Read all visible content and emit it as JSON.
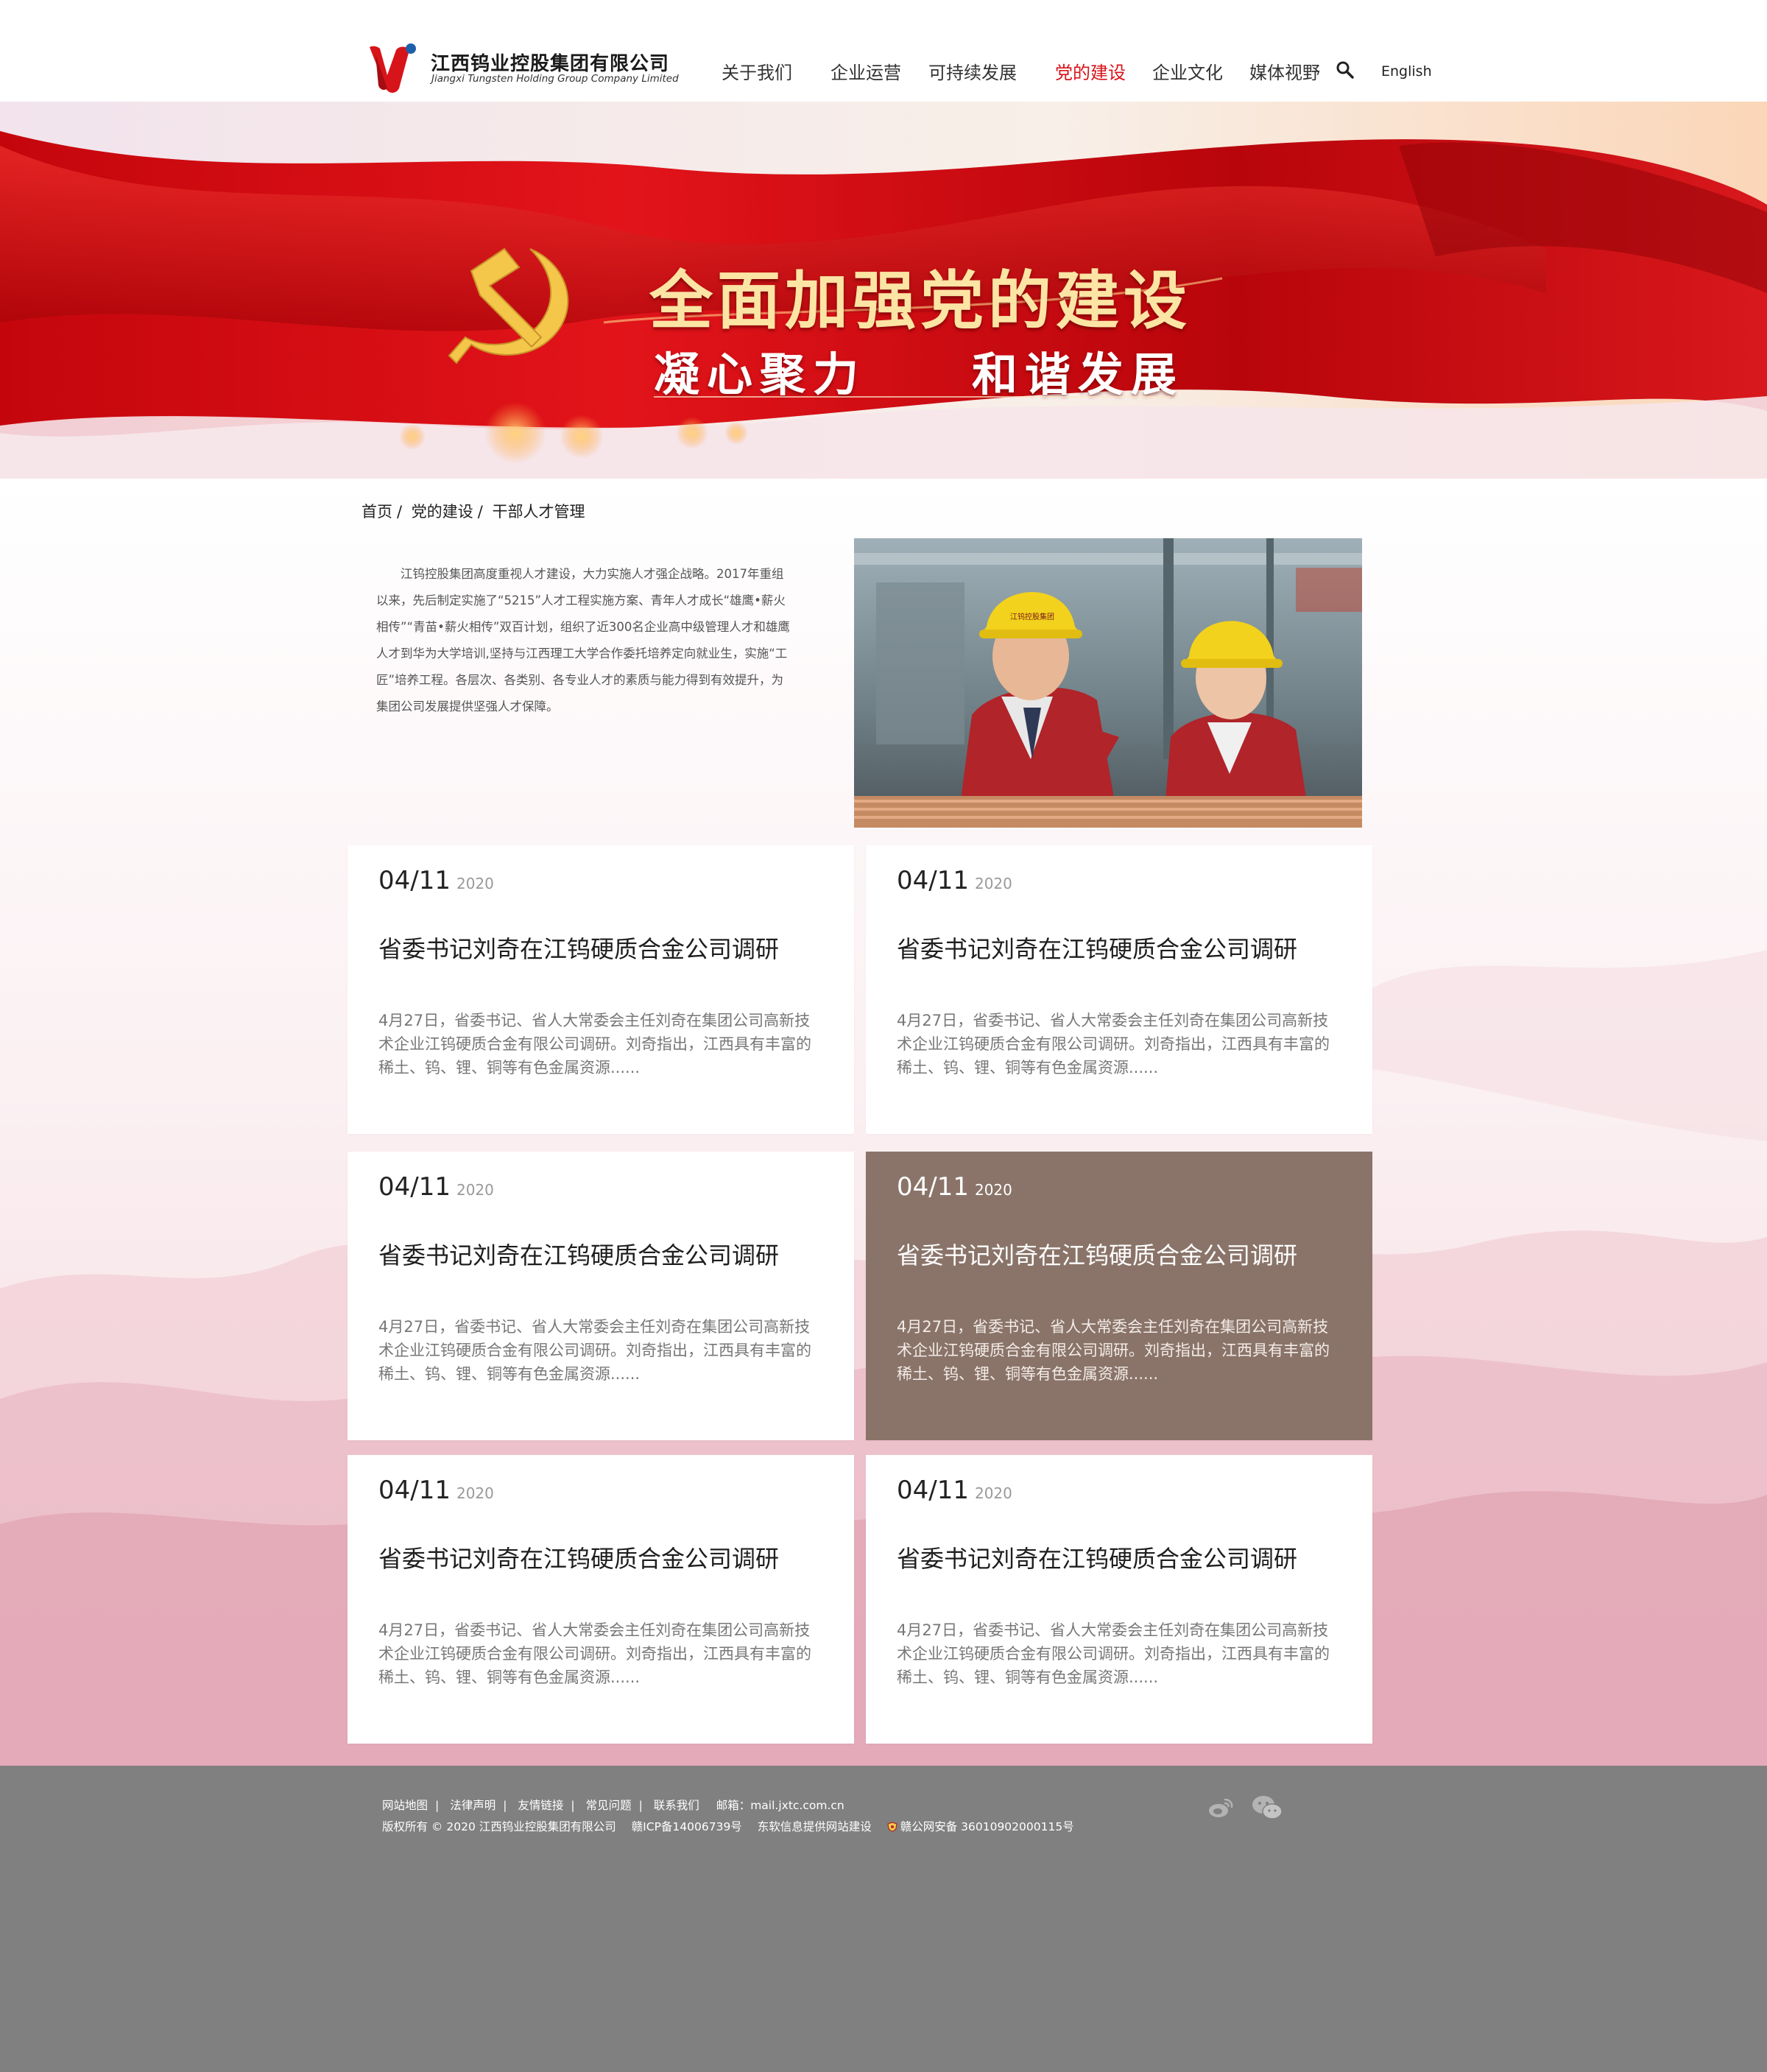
{
  "header": {
    "logo_cn": "江西钨业控股集团有限公司",
    "logo_en": "Jiangxi Tungsten Holding Group Company Limited",
    "nav": [
      {
        "label": "关于我们",
        "active": false
      },
      {
        "label": "企业运营",
        "active": false
      },
      {
        "label": "可持续发展",
        "active": false
      },
      {
        "label": "党的建设",
        "active": true
      },
      {
        "label": "企业文化",
        "active": false
      },
      {
        "label": "媒体视野",
        "active": false
      }
    ],
    "search_icon": "search-icon",
    "language": "English"
  },
  "banner": {
    "title": "全面加强党的建设",
    "subtitle_left": "凝心聚力",
    "subtitle_right": "和谐发展",
    "emblem_icon": "hammer-sickle-icon"
  },
  "breadcrumb": [
    {
      "label": "首页",
      "sep": "/"
    },
    {
      "label": "党的建设",
      "sep": "/"
    },
    {
      "label": "干部人才管理",
      "sep": ""
    }
  ],
  "intro": {
    "text": "江钨控股集团高度重视人才建设，大力实施人才强企战略。2017年重组以来，先后制定实施了“5215”人才工程实施方案、青年人才成长“雄鹰•薪火相传”“青苗•薪火相传”双百计划，组织了近300名企业高中级管理人才和雄鹰人才到华为大学培训,坚持与江西理工大学合作委托培养定向就业生，实施“工匠”培养工程。各层次、各类别、各专业人才的素质与能力得到有效提升，为集团公司发展提供坚强人才保障。",
    "helmet_text": "江钨控股集团"
  },
  "news": [
    {
      "date": "04/11",
      "year": "2020",
      "title": "省委书记刘奇在江钨硬质合金公司调研",
      "summary": "4月27日，省委书记、省人大常委会主任刘奇在集团公司高新技术企业江钨硬质合金有限公司调研。刘奇指出，江西具有丰富的稀土、钨、锂、铜等有色金属资源......",
      "highlight": false
    },
    {
      "date": "04/11",
      "year": "2020",
      "title": "省委书记刘奇在江钨硬质合金公司调研",
      "summary": "4月27日，省委书记、省人大常委会主任刘奇在集团公司高新技术企业江钨硬质合金有限公司调研。刘奇指出，江西具有丰富的稀土、钨、锂、铜等有色金属资源......",
      "highlight": false
    },
    {
      "date": "04/11",
      "year": "2020",
      "title": "省委书记刘奇在江钨硬质合金公司调研",
      "summary": "4月27日，省委书记、省人大常委会主任刘奇在集团公司高新技术企业江钨硬质合金有限公司调研。刘奇指出，江西具有丰富的稀土、钨、锂、铜等有色金属资源......",
      "highlight": false
    },
    {
      "date": "04/11",
      "year": "2020",
      "title": "省委书记刘奇在江钨硬质合金公司调研",
      "summary": "4月27日，省委书记、省人大常委会主任刘奇在集团公司高新技术企业江钨硬质合金有限公司调研。刘奇指出，江西具有丰富的稀土、钨、锂、铜等有色金属资源......",
      "highlight": true
    },
    {
      "date": "04/11",
      "year": "2020",
      "title": "省委书记刘奇在江钨硬质合金公司调研",
      "summary": "4月27日，省委书记、省人大常委会主任刘奇在集团公司高新技术企业江钨硬质合金有限公司调研。刘奇指出，江西具有丰富的稀土、钨、锂、铜等有色金属资源......",
      "highlight": false
    },
    {
      "date": "04/11",
      "year": "2020",
      "title": "省委书记刘奇在江钨硬质合金公司调研",
      "summary": "4月27日，省委书记、省人大常委会主任刘奇在集团公司高新技术企业江钨硬质合金有限公司调研。刘奇指出，江西具有丰富的稀土、钨、锂、铜等有色金属资源......",
      "highlight": false
    }
  ],
  "footer": {
    "links": [
      "网站地图",
      "法律声明",
      "友情链接",
      "常见问题",
      "联系我们"
    ],
    "email": "邮箱：mail.jxtc.com.cn",
    "copyright": "版权所有 © 2020 江西钨业控股集团有限公司",
    "icp": "赣ICP备14006739号",
    "builder": "东软信息提供网站建设",
    "police": "赣公网安备 36010902000115号",
    "social_icons": [
      "weibo-icon",
      "wechat-icon"
    ]
  },
  "colors": {
    "accent_red": "#d7141a",
    "highlight_card": "#8a7469",
    "footer_bg": "#808080"
  }
}
